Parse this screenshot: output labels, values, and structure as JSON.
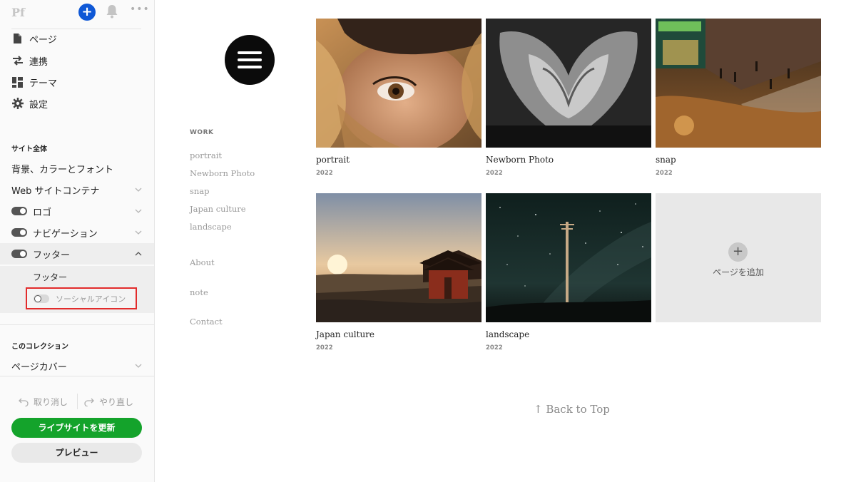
{
  "sidebar": {
    "logo": "Pf",
    "add_symbol": "+",
    "more_symbol": "•••",
    "menu": [
      {
        "label": "ページ",
        "icon": "page-icon"
      },
      {
        "label": "連携",
        "icon": "arrows-icon"
      },
      {
        "label": "テーマ",
        "icon": "theme-grid-icon"
      },
      {
        "label": "設定",
        "icon": "gear-icon"
      }
    ],
    "site_section_label": "サイト全体",
    "site_rows": [
      {
        "label": "背景、カラーとフォント"
      },
      {
        "label": "Web サイトコンテナ"
      },
      {
        "label": "ロゴ",
        "toggle": true
      },
      {
        "label": "ナビゲーション",
        "toggle": true
      },
      {
        "label": "フッター",
        "toggle": true,
        "expanded": true
      }
    ],
    "footer_sub_item": "フッター",
    "social_icon_label": "ソーシャルアイコン",
    "collection_section_label": "このコレクション",
    "page_cover_label": "ページカバー",
    "undo_label": "取り消し",
    "redo_label": "やり直し",
    "update_button": "ライブサイトを更新",
    "preview_button": "プレビュー",
    "colors": {
      "primary_blue": "#0f58d6",
      "update_green": "#14a32b",
      "highlight_red": "#e22b2b"
    }
  },
  "preview": {
    "nav_label": "WORK",
    "work_links": [
      "portrait",
      "Newborn Photo",
      "snap",
      "Japan culture",
      "landscape"
    ],
    "other_links": [
      "About",
      "note",
      "Contact"
    ],
    "gallery": [
      {
        "title": "portrait",
        "year": "2022"
      },
      {
        "title": "Newborn Photo",
        "year": "2022"
      },
      {
        "title": "snap",
        "year": "2022"
      },
      {
        "title": "Japan culture",
        "year": "2022"
      },
      {
        "title": "landscape",
        "year": "2022"
      }
    ],
    "add_page_label": "ページを追加",
    "add_page_symbol": "+",
    "back_to_top": "↑  Back to Top"
  }
}
